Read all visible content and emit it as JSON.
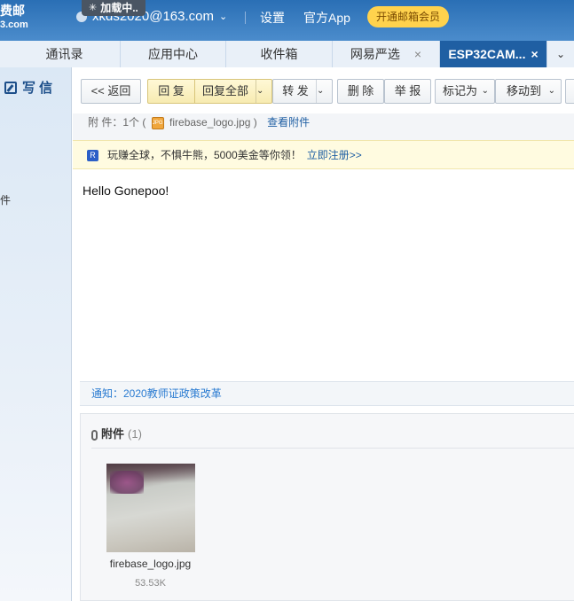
{
  "header": {
    "logo_line1": "费邮",
    "logo_line2": "3.com",
    "loading_text": "加载中..",
    "account": "xkds2020@163.com",
    "links": [
      "设置",
      "官方App"
    ],
    "vip_button": "开通邮箱会员"
  },
  "tabs": [
    {
      "label": "通讯录"
    },
    {
      "label": "应用中心"
    },
    {
      "label": "收件箱"
    },
    {
      "label": "网易严选",
      "close": "×"
    },
    {
      "label": "ESP32CAM...",
      "close": "×",
      "active": true
    }
  ],
  "sidebar": {
    "write_label": "写 信",
    "fragment": "件"
  },
  "toolbar": {
    "back": "<< 返回",
    "reply": "回 复",
    "reply_all": "回复全部",
    "forward": "转 发",
    "delete": "删 除",
    "report": "举 报",
    "mark_as": "标记为",
    "move_to": "移动到"
  },
  "attachment_line": {
    "label": "附 件：1个 (",
    "filename": "firebase_logo.jpg",
    "close_paren": ")",
    "view_link": "查看附件"
  },
  "promo": {
    "icon": "R",
    "text": "玩赚全球，不惧牛熊，5000美金等你领！",
    "link": "立即注册>>"
  },
  "mail": {
    "body": "Hello Gonepoo!"
  },
  "notice": {
    "text": "通知：2020教师证政策改革"
  },
  "attachments": {
    "title": "附件",
    "count": "(1)",
    "items": [
      {
        "name": "firebase_logo.jpg",
        "size": "53.53K"
      }
    ]
  }
}
